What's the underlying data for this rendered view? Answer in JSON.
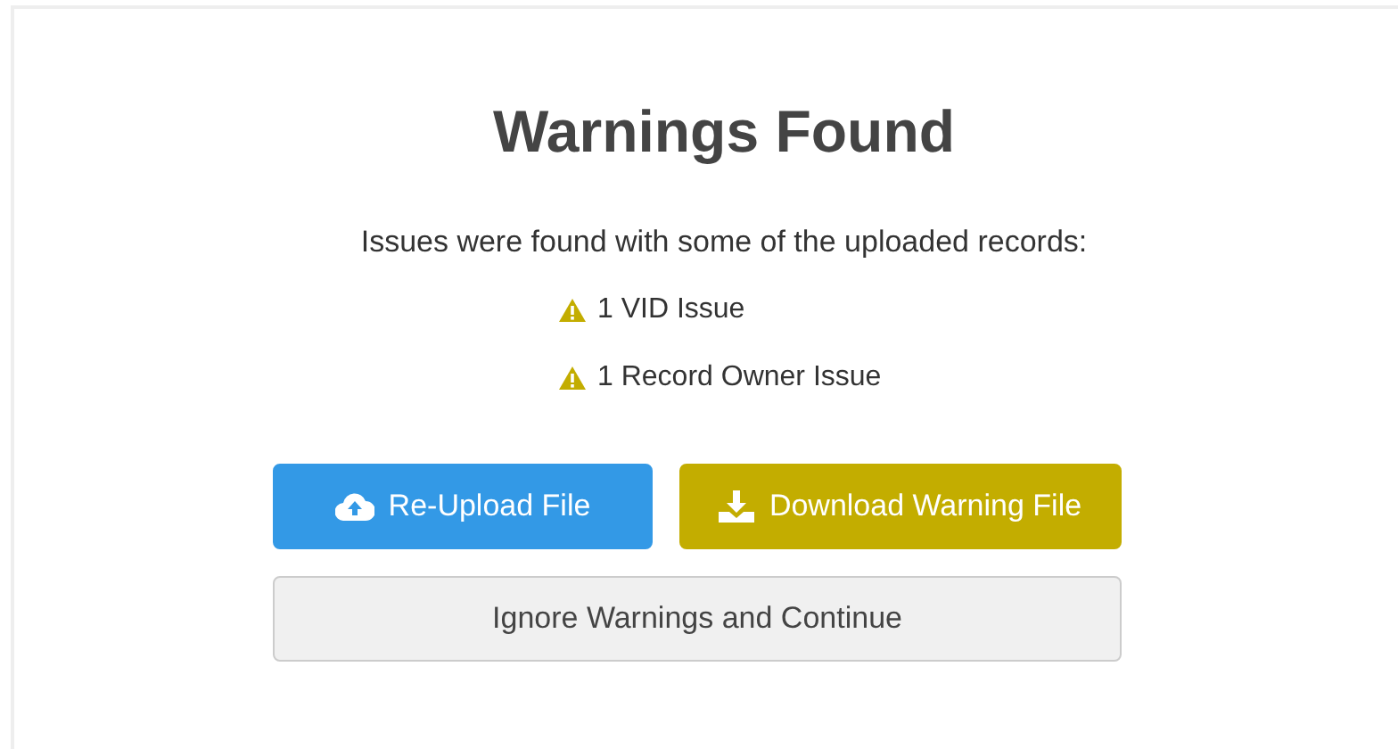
{
  "title": "Warnings Found",
  "message": "Issues were found with some of the uploaded records:",
  "issues": [
    {
      "label": "1 VID Issue"
    },
    {
      "label": "1 Record Owner Issue"
    }
  ],
  "buttons": [
    {
      "kind": "upload",
      "label": "Re-Upload File"
    },
    {
      "kind": "download",
      "label": "Download Warning File"
    },
    {
      "kind": "plain",
      "label": "Ignore Warnings and Continue"
    }
  ]
}
